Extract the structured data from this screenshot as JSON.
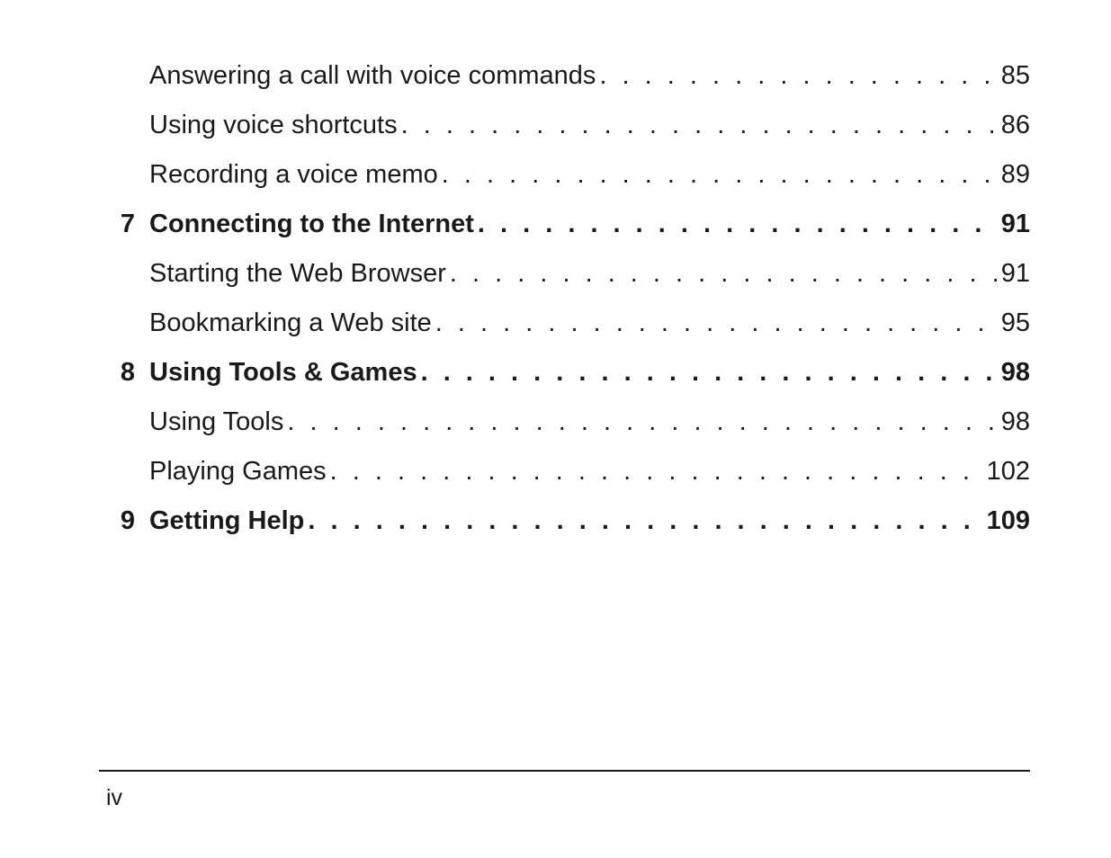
{
  "dots": ". . . . . . . . . . . . . . . . . . . . . . . . . . . . . . . . . . . . . . . . . . . . . . . . . . . . . . . . . . . . . . . . . . . . . . . . . . . . . . . . . . . . . . . . . . . . . . . . . . . . . . . . . . . . . . . . . . . . . . . . . . .",
  "toc": [
    {
      "num": "",
      "title": "Answering a call with voice commands ",
      "page": "85",
      "bold": false
    },
    {
      "num": "",
      "title": "Using voice shortcuts",
      "page": "86",
      "bold": false
    },
    {
      "num": "",
      "title": "Recording a voice memo ",
      "page": "89",
      "bold": false
    },
    {
      "num": "7",
      "title": "Connecting to the Internet",
      "page": "91",
      "bold": true
    },
    {
      "num": "",
      "title": "Starting the Web Browser ",
      "page": "91",
      "bold": false
    },
    {
      "num": "",
      "title": "Bookmarking a Web site ",
      "page": "95",
      "bold": false
    },
    {
      "num": "8",
      "title": "Using Tools & Games",
      "page": "98",
      "bold": true
    },
    {
      "num": "",
      "title": "Using Tools",
      "page": "98",
      "bold": false
    },
    {
      "num": "",
      "title": "Playing Games ",
      "page": "102",
      "bold": false
    },
    {
      "num": "9",
      "title": "Getting Help",
      "page": " 109",
      "bold": true
    }
  ],
  "page_number": "iv"
}
